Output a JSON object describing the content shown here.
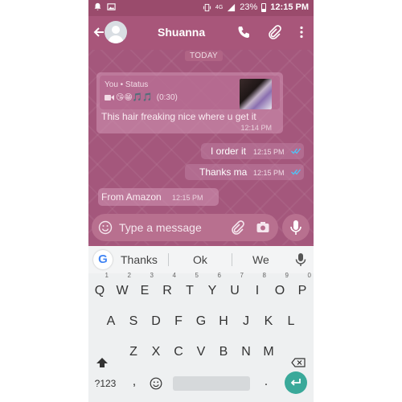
{
  "status_bar": {
    "network": "4G",
    "battery": "23%",
    "time": "12:15 PM"
  },
  "app_bar": {
    "contact_name": "Shuanna"
  },
  "chat": {
    "date_label": "TODAY",
    "messages": [
      {
        "direction": "incoming",
        "reply_to": {
          "author": "You • Status",
          "duration": "(0:30)",
          "emojis": "😘😁🎵🎵"
        },
        "text": "This hair freaking nice where u get it",
        "time": "12:14 PM"
      },
      {
        "direction": "outgoing",
        "text": "I order it",
        "time": "12:15 PM",
        "status": "read"
      },
      {
        "direction": "outgoing",
        "text": "Thanks ma",
        "time": "12:15 PM",
        "status": "read"
      },
      {
        "direction": "incoming",
        "text": "From Amazon",
        "time": "12:15 PM"
      }
    ]
  },
  "composer": {
    "placeholder": "Type a message"
  },
  "keyboard": {
    "suggestions": [
      "Thanks",
      "Ok",
      "We"
    ],
    "row1": [
      "Q",
      "W",
      "E",
      "R",
      "T",
      "Y",
      "U",
      "I",
      "O",
      "P"
    ],
    "row1_hints": [
      "1",
      "2",
      "3",
      "4",
      "5",
      "6",
      "7",
      "8",
      "9",
      "0"
    ],
    "row2": [
      "A",
      "S",
      "D",
      "F",
      "G",
      "H",
      "J",
      "K",
      "L"
    ],
    "row3": [
      "Z",
      "X",
      "C",
      "V",
      "B",
      "N",
      "M"
    ],
    "symbols_key": "?123",
    "comma_key": ",",
    "period_key": "."
  },
  "colors": {
    "header": "#a8567a",
    "chat_bg": "#a4577c",
    "read_ticks": "#4fc3f7",
    "enter_key": "#3aa99a"
  }
}
